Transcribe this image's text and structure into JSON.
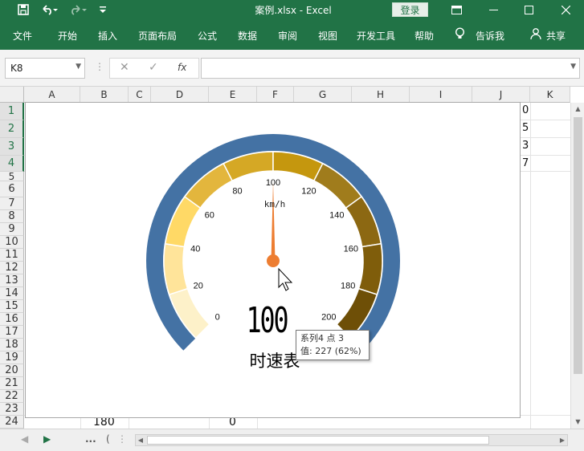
{
  "window": {
    "title": "案例.xlsx  -  Excel",
    "login_label": "登录",
    "save_icon": "save-icon",
    "undo_icon": "undo-icon",
    "redo_icon": "redo-icon"
  },
  "ribbon": {
    "tabs": [
      "文件",
      "开始",
      "插入",
      "页面布局",
      "公式",
      "数据",
      "审阅",
      "视图",
      "开发工具",
      "帮助"
    ],
    "tell_me": "告诉我",
    "share": "共享"
  },
  "formula_bar": {
    "name_box": "K8",
    "fx_label": "fx",
    "formula_value": ""
  },
  "grid": {
    "columns": [
      "A",
      "B",
      "C",
      "D",
      "E",
      "F",
      "G",
      "H",
      "I",
      "J",
      "K"
    ],
    "rows": [
      "1",
      "2",
      "3",
      "4",
      "5",
      "6",
      "7",
      "8",
      "9",
      "10",
      "11",
      "12",
      "13",
      "14",
      "15",
      "16",
      "17",
      "18",
      "19",
      "20",
      "21",
      "22",
      "23",
      "24"
    ],
    "selected_rows": [
      "1",
      "2",
      "3",
      "4"
    ],
    "cells": {
      "J1": "0",
      "J2": "5",
      "J3": "3",
      "J4": "7",
      "B24": "180",
      "E24": "0"
    }
  },
  "chart": {
    "title": "时速表",
    "value_display": "100",
    "unit": "km/h",
    "tooltip_line1": "系列4 点 3",
    "tooltip_line2": "值: 227 (62%)",
    "colors": {
      "outer_ring": "#4472a4",
      "segments": [
        "#fdf1c9",
        "#ffe49a",
        "#ffd966",
        "#e3b63d",
        "#d5a825",
        "#c5970e",
        "#a07c1c",
        "#8c6812",
        "#7f5d0b",
        "#6e4f07"
      ],
      "needle": "#ed7d31"
    }
  },
  "chart_data": {
    "type": "gauge",
    "title": "时速表",
    "unit": "km/h",
    "min": 0,
    "max": 200,
    "ticks": [
      0,
      20,
      40,
      60,
      80,
      100,
      120,
      140,
      160,
      180,
      200
    ],
    "value": 100
  },
  "status_bar": {
    "sheet_nav_more": "...",
    "sheet_nav_paren": "("
  }
}
